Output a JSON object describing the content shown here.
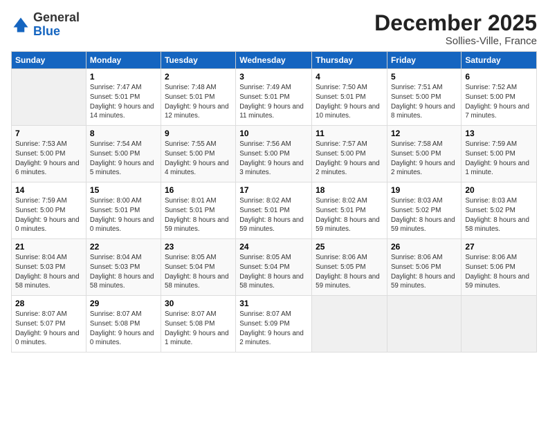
{
  "logo": {
    "general": "General",
    "blue": "Blue"
  },
  "header": {
    "title": "December 2025",
    "subtitle": "Sollies-Ville, France"
  },
  "days_of_week": [
    "Sunday",
    "Monday",
    "Tuesday",
    "Wednesday",
    "Thursday",
    "Friday",
    "Saturday"
  ],
  "weeks": [
    [
      {
        "day": "",
        "sunrise": "",
        "sunset": "",
        "daylight": "",
        "empty": true
      },
      {
        "day": "1",
        "sunrise": "Sunrise: 7:47 AM",
        "sunset": "Sunset: 5:01 PM",
        "daylight": "Daylight: 9 hours and 14 minutes."
      },
      {
        "day": "2",
        "sunrise": "Sunrise: 7:48 AM",
        "sunset": "Sunset: 5:01 PM",
        "daylight": "Daylight: 9 hours and 12 minutes."
      },
      {
        "day": "3",
        "sunrise": "Sunrise: 7:49 AM",
        "sunset": "Sunset: 5:01 PM",
        "daylight": "Daylight: 9 hours and 11 minutes."
      },
      {
        "day": "4",
        "sunrise": "Sunrise: 7:50 AM",
        "sunset": "Sunset: 5:01 PM",
        "daylight": "Daylight: 9 hours and 10 minutes."
      },
      {
        "day": "5",
        "sunrise": "Sunrise: 7:51 AM",
        "sunset": "Sunset: 5:00 PM",
        "daylight": "Daylight: 9 hours and 8 minutes."
      },
      {
        "day": "6",
        "sunrise": "Sunrise: 7:52 AM",
        "sunset": "Sunset: 5:00 PM",
        "daylight": "Daylight: 9 hours and 7 minutes."
      }
    ],
    [
      {
        "day": "7",
        "sunrise": "Sunrise: 7:53 AM",
        "sunset": "Sunset: 5:00 PM",
        "daylight": "Daylight: 9 hours and 6 minutes."
      },
      {
        "day": "8",
        "sunrise": "Sunrise: 7:54 AM",
        "sunset": "Sunset: 5:00 PM",
        "daylight": "Daylight: 9 hours and 5 minutes."
      },
      {
        "day": "9",
        "sunrise": "Sunrise: 7:55 AM",
        "sunset": "Sunset: 5:00 PM",
        "daylight": "Daylight: 9 hours and 4 minutes."
      },
      {
        "day": "10",
        "sunrise": "Sunrise: 7:56 AM",
        "sunset": "Sunset: 5:00 PM",
        "daylight": "Daylight: 9 hours and 3 minutes."
      },
      {
        "day": "11",
        "sunrise": "Sunrise: 7:57 AM",
        "sunset": "Sunset: 5:00 PM",
        "daylight": "Daylight: 9 hours and 2 minutes."
      },
      {
        "day": "12",
        "sunrise": "Sunrise: 7:58 AM",
        "sunset": "Sunset: 5:00 PM",
        "daylight": "Daylight: 9 hours and 2 minutes."
      },
      {
        "day": "13",
        "sunrise": "Sunrise: 7:59 AM",
        "sunset": "Sunset: 5:00 PM",
        "daylight": "Daylight: 9 hours and 1 minute."
      }
    ],
    [
      {
        "day": "14",
        "sunrise": "Sunrise: 7:59 AM",
        "sunset": "Sunset: 5:00 PM",
        "daylight": "Daylight: 9 hours and 0 minutes."
      },
      {
        "day": "15",
        "sunrise": "Sunrise: 8:00 AM",
        "sunset": "Sunset: 5:01 PM",
        "daylight": "Daylight: 9 hours and 0 minutes."
      },
      {
        "day": "16",
        "sunrise": "Sunrise: 8:01 AM",
        "sunset": "Sunset: 5:01 PM",
        "daylight": "Daylight: 8 hours and 59 minutes."
      },
      {
        "day": "17",
        "sunrise": "Sunrise: 8:02 AM",
        "sunset": "Sunset: 5:01 PM",
        "daylight": "Daylight: 8 hours and 59 minutes."
      },
      {
        "day": "18",
        "sunrise": "Sunrise: 8:02 AM",
        "sunset": "Sunset: 5:01 PM",
        "daylight": "Daylight: 8 hours and 59 minutes."
      },
      {
        "day": "19",
        "sunrise": "Sunrise: 8:03 AM",
        "sunset": "Sunset: 5:02 PM",
        "daylight": "Daylight: 8 hours and 59 minutes."
      },
      {
        "day": "20",
        "sunrise": "Sunrise: 8:03 AM",
        "sunset": "Sunset: 5:02 PM",
        "daylight": "Daylight: 8 hours and 58 minutes."
      }
    ],
    [
      {
        "day": "21",
        "sunrise": "Sunrise: 8:04 AM",
        "sunset": "Sunset: 5:03 PM",
        "daylight": "Daylight: 8 hours and 58 minutes."
      },
      {
        "day": "22",
        "sunrise": "Sunrise: 8:04 AM",
        "sunset": "Sunset: 5:03 PM",
        "daylight": "Daylight: 8 hours and 58 minutes."
      },
      {
        "day": "23",
        "sunrise": "Sunrise: 8:05 AM",
        "sunset": "Sunset: 5:04 PM",
        "daylight": "Daylight: 8 hours and 58 minutes."
      },
      {
        "day": "24",
        "sunrise": "Sunrise: 8:05 AM",
        "sunset": "Sunset: 5:04 PM",
        "daylight": "Daylight: 8 hours and 58 minutes."
      },
      {
        "day": "25",
        "sunrise": "Sunrise: 8:06 AM",
        "sunset": "Sunset: 5:05 PM",
        "daylight": "Daylight: 8 hours and 59 minutes."
      },
      {
        "day": "26",
        "sunrise": "Sunrise: 8:06 AM",
        "sunset": "Sunset: 5:06 PM",
        "daylight": "Daylight: 8 hours and 59 minutes."
      },
      {
        "day": "27",
        "sunrise": "Sunrise: 8:06 AM",
        "sunset": "Sunset: 5:06 PM",
        "daylight": "Daylight: 8 hours and 59 minutes."
      }
    ],
    [
      {
        "day": "28",
        "sunrise": "Sunrise: 8:07 AM",
        "sunset": "Sunset: 5:07 PM",
        "daylight": "Daylight: 9 hours and 0 minutes."
      },
      {
        "day": "29",
        "sunrise": "Sunrise: 8:07 AM",
        "sunset": "Sunset: 5:08 PM",
        "daylight": "Daylight: 9 hours and 0 minutes."
      },
      {
        "day": "30",
        "sunrise": "Sunrise: 8:07 AM",
        "sunset": "Sunset: 5:08 PM",
        "daylight": "Daylight: 9 hours and 1 minute."
      },
      {
        "day": "31",
        "sunrise": "Sunrise: 8:07 AM",
        "sunset": "Sunset: 5:09 PM",
        "daylight": "Daylight: 9 hours and 2 minutes."
      },
      {
        "day": "",
        "sunrise": "",
        "sunset": "",
        "daylight": "",
        "empty": true
      },
      {
        "day": "",
        "sunrise": "",
        "sunset": "",
        "daylight": "",
        "empty": true
      },
      {
        "day": "",
        "sunrise": "",
        "sunset": "",
        "daylight": "",
        "empty": true
      }
    ]
  ]
}
